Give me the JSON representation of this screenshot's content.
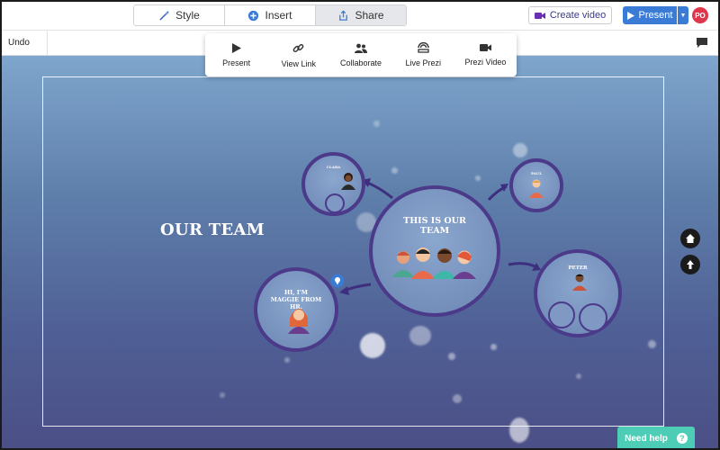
{
  "toolbar": {
    "tabs": [
      {
        "label": "Style",
        "icon": "magic-wand-icon"
      },
      {
        "label": "Insert",
        "icon": "plus-circle-icon"
      },
      {
        "label": "Share",
        "icon": "upload-icon"
      }
    ],
    "create_video_label": "Create video",
    "present_label": "Present",
    "avatar_initials": "PO"
  },
  "secondbar": {
    "undo_label": "Undo"
  },
  "share_menu": {
    "items": [
      {
        "label": "Present",
        "icon": "play-icon"
      },
      {
        "label": "View Link",
        "icon": "link-icon"
      },
      {
        "label": "Collaborate",
        "icon": "users-icon"
      },
      {
        "label": "Live Prezi",
        "icon": "live-broadcast-icon"
      },
      {
        "label": "Prezi Video",
        "icon": "video-camera-icon"
      }
    ]
  },
  "canvas": {
    "title": "OUR TEAM",
    "center_topic": "THIS IS OUR TEAM",
    "topics": {
      "left": "HI, I'M MAGGIE FROM HR.",
      "top_left": "CLARA",
      "top_right": "PAUL",
      "right": "PETER"
    }
  },
  "help": {
    "label": "Need help",
    "icon_glyph": "?"
  },
  "colors": {
    "accent": "#3a7bd5",
    "avatar": "#e0364b",
    "circle_border": "#4b3a8a",
    "help": "#4ecdb6"
  }
}
